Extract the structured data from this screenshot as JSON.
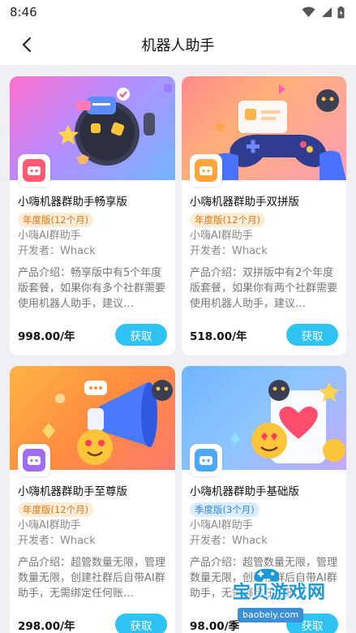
{
  "status_bar": {
    "time": "8:46"
  },
  "header": {
    "title": "机器人助手"
  },
  "cards": [
    {
      "name": "小嗨机器群助手畅享版",
      "tag": "年度版(12个月)",
      "tag_type": "yearly",
      "subtitle": "小嗨AI群助手",
      "developer": "开发者：Whack",
      "description": "产品介绍：畅享版中有5个年度版套餐，如果你有多个社群需要使用机器人助手，建议…",
      "price": "998.00/年",
      "button": "获取",
      "icon_color": "#ff5a73"
    },
    {
      "name": "小嗨机器群助手双拼版",
      "tag": "年度版(12个月)",
      "tag_type": "yearly",
      "subtitle": "小嗨AI群助手",
      "developer": "开发者：Whack",
      "description": "产品介绍：双拼版中有2个年度版套餐，如果你有两个社群需要使用机器人助手，建议…",
      "price": "518.00/年",
      "button": "获取",
      "icon_color": "#ffa43b"
    },
    {
      "name": "小嗨机器群助手至尊版",
      "tag": "年度版(12个月)",
      "tag_type": "yearly",
      "subtitle": "小嗨AI群助手",
      "developer": "开发者：Whack",
      "description": "产品介绍：超管数量无限，管理数量无限，创建社群后自带AI群助手，无需绑定任何账…",
      "price": "298.00/年",
      "button": "获取",
      "icon_color": "#a06cf0"
    },
    {
      "name": "小嗨机器群助手基础版",
      "tag": "季度版(3个月)",
      "tag_type": "season",
      "subtitle": "小嗨AI群助手",
      "developer": "开发者：Whack",
      "description": "产品介绍：超管数量无限，管理数量无限，创建社群后自带AI群助手，无需绑定任何账…",
      "price": "98.00/季",
      "button": "获取",
      "icon_color": "#4aa8ff"
    }
  ],
  "watermark": {
    "title": "宝贝游戏网",
    "url": "baobeiy.com"
  }
}
